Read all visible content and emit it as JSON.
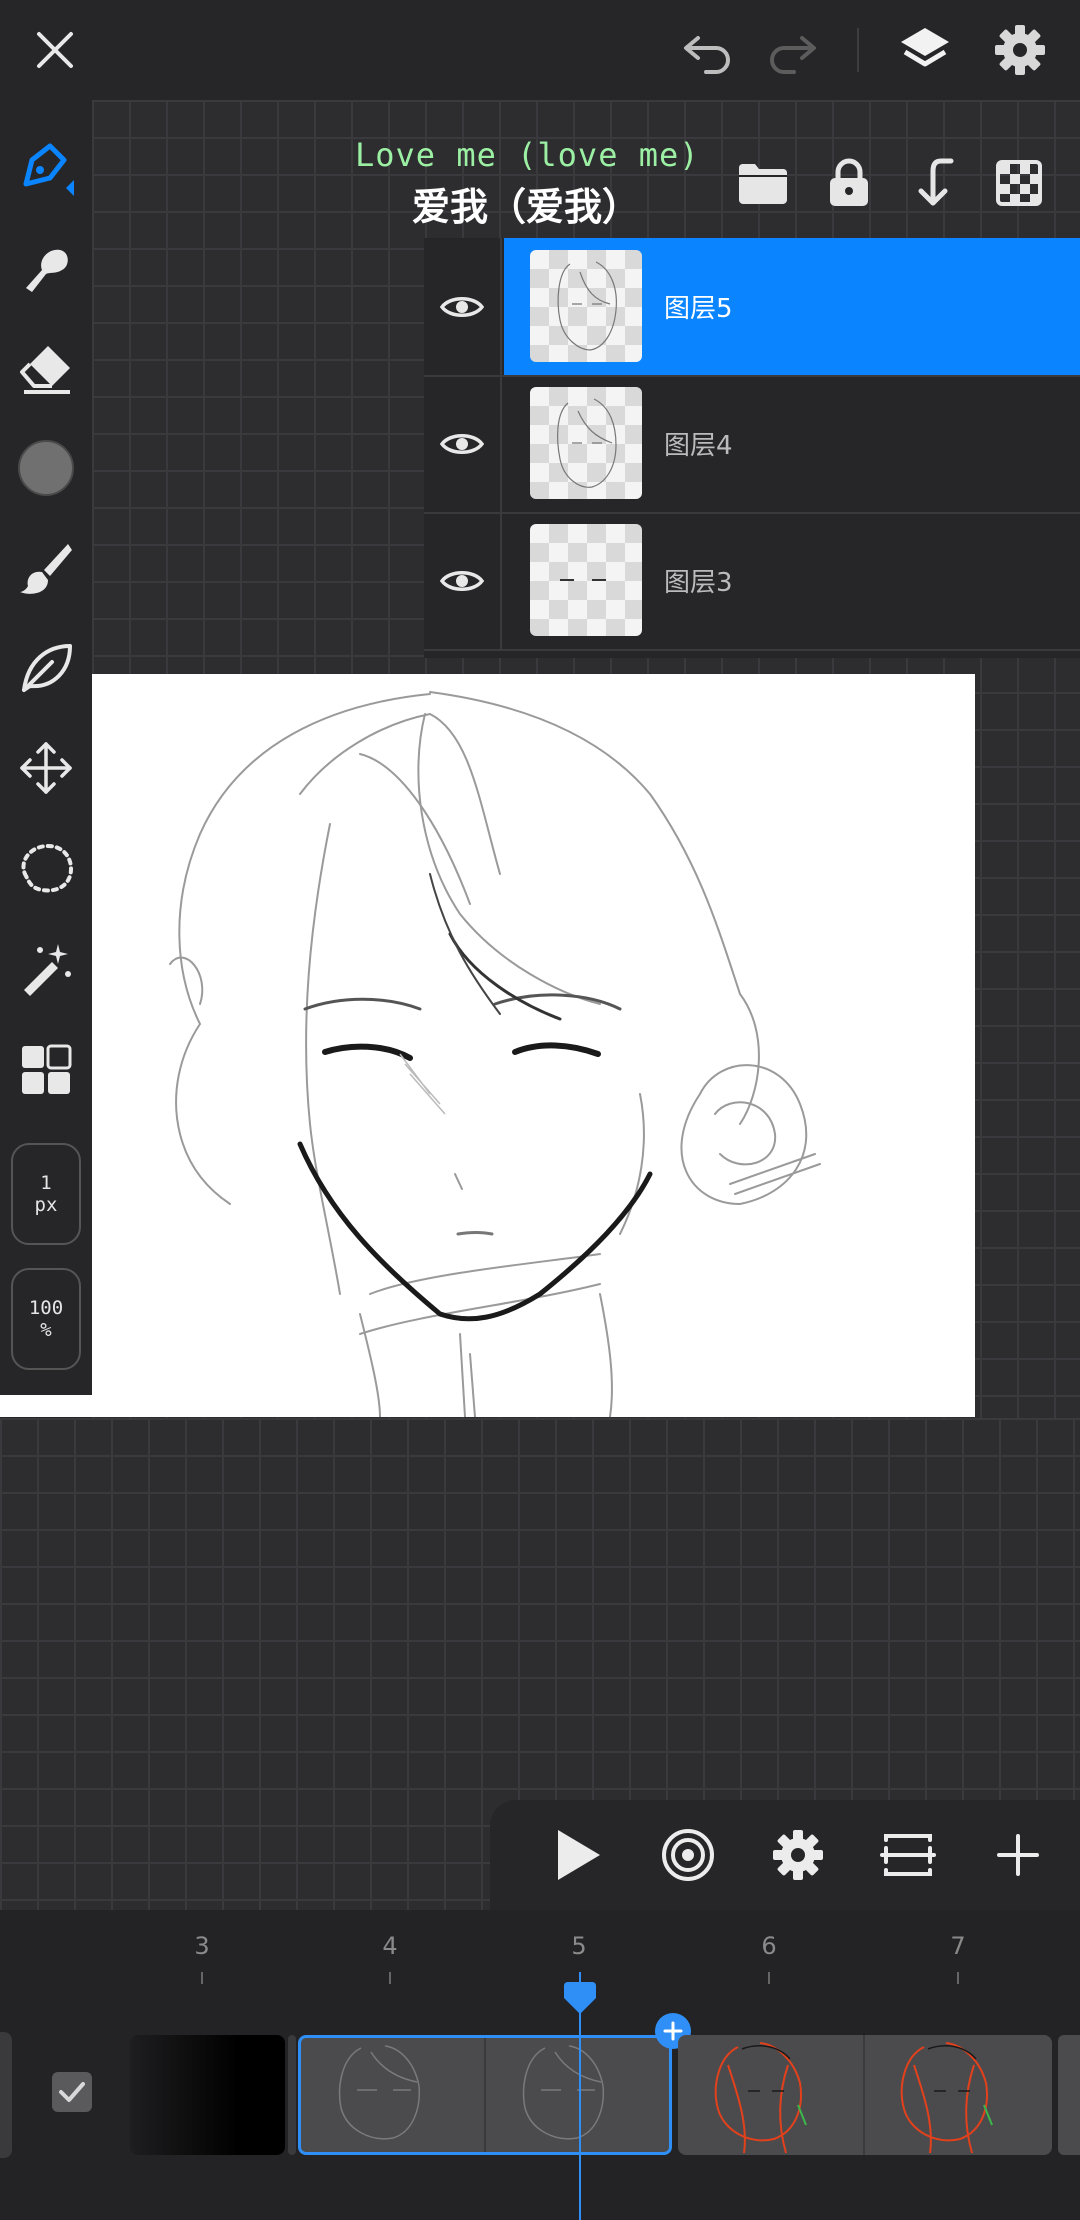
{
  "topbar": {
    "close_icon": "close-icon",
    "undo_icon": "undo-icon",
    "redo_icon": "redo-icon",
    "layers_icon": "layers-icon",
    "settings_icon": "gear-icon"
  },
  "toolbar": {
    "tools": [
      "pen-tool-icon",
      "smudge-tool-icon",
      "eraser-icon",
      "color-swatch",
      "brush-icon",
      "leaf-brush-icon",
      "move-icon",
      "lasso-icon",
      "magic-wand-icon",
      "grid-icon"
    ],
    "size_value": "1",
    "size_unit": "px",
    "opacity_value": "100",
    "opacity_unit": "%",
    "accent": "#0a84ff"
  },
  "lyrics": {
    "line1": "Love me (love me)",
    "line2": "爱我（爱我）"
  },
  "layers": [
    {
      "name": "图层5",
      "selected": true
    },
    {
      "name": "图层4",
      "selected": false
    },
    {
      "name": "图层3",
      "selected": false
    }
  ],
  "timeline": {
    "ticks": [
      "3",
      "4",
      "5",
      "6",
      "7"
    ],
    "current_frame": "5"
  }
}
